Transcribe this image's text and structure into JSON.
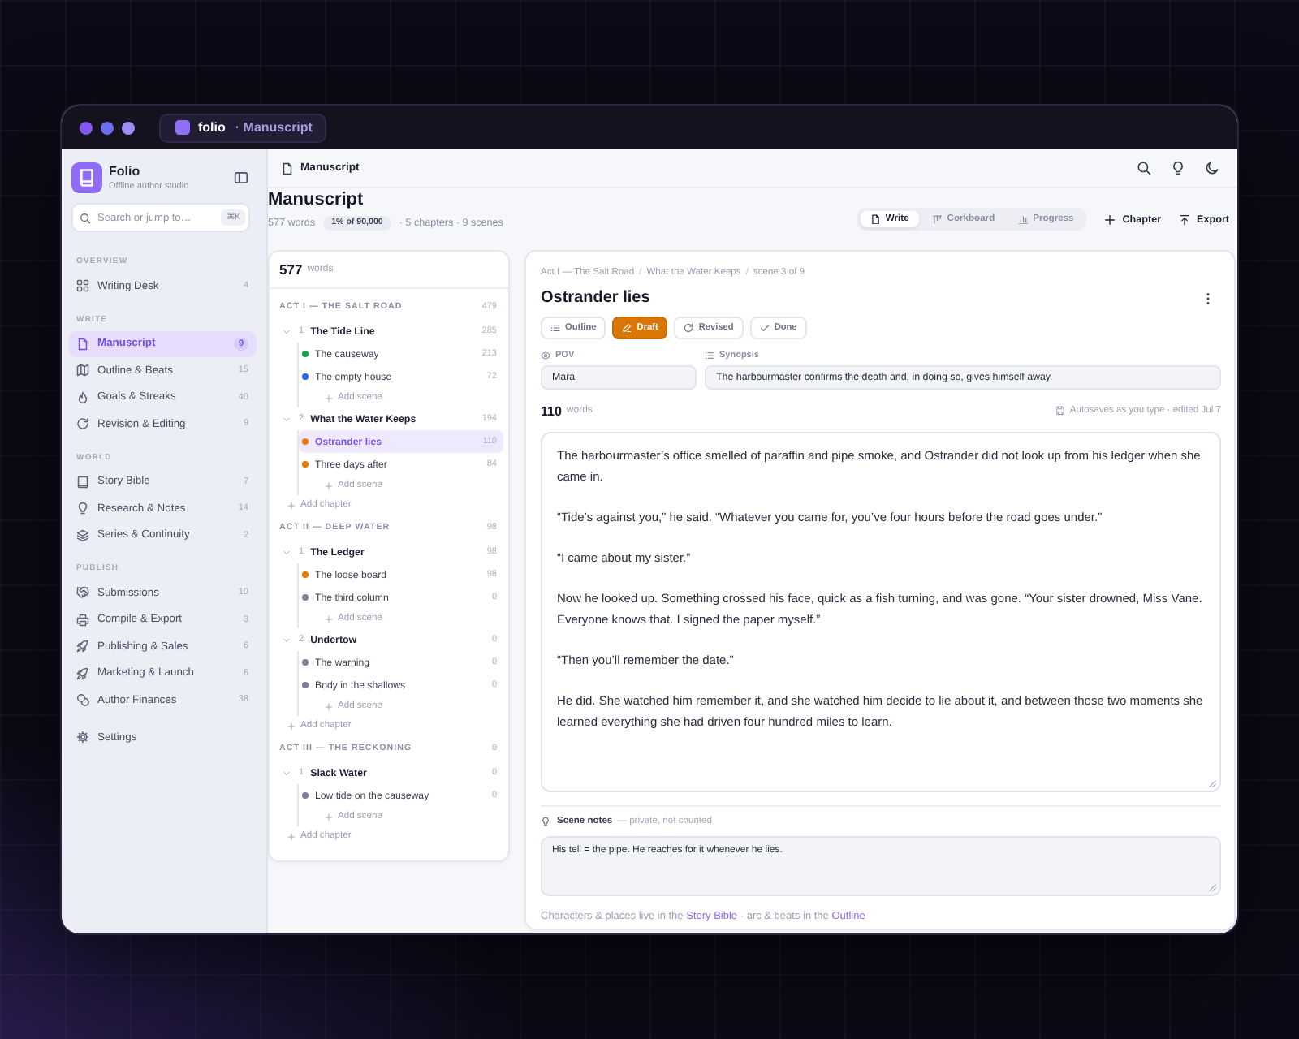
{
  "window": {
    "app_name": "folio",
    "page": "· Manuscript"
  },
  "sidebar": {
    "brand": {
      "name": "Folio",
      "tagline": "Offline author studio"
    },
    "search": {
      "placeholder": "Search or jump to…",
      "shortcut": "⌘K"
    },
    "sections": [
      {
        "heading": "OVERVIEW",
        "items": [
          {
            "label": "Writing Desk",
            "count": "4",
            "selected": false
          }
        ]
      },
      {
        "heading": "WRITE",
        "items": [
          {
            "label": "Manuscript",
            "count": "9",
            "selected": true
          },
          {
            "label": "Outline & Beats",
            "count": "15",
            "selected": false
          },
          {
            "label": "Goals & Streaks",
            "count": "40",
            "selected": false
          },
          {
            "label": "Revision & Editing",
            "count": "9",
            "selected": false
          }
        ]
      },
      {
        "heading": "WORLD",
        "items": [
          {
            "label": "Story Bible",
            "count": "7",
            "selected": false
          },
          {
            "label": "Research & Notes",
            "count": "14",
            "selected": false
          },
          {
            "label": "Series & Continuity",
            "count": "2",
            "selected": false
          }
        ]
      },
      {
        "heading": "PUBLISH",
        "items": [
          {
            "label": "Submissions",
            "count": "10",
            "selected": false
          },
          {
            "label": "Compile & Export",
            "count": "3",
            "selected": false
          },
          {
            "label": "Publishing & Sales",
            "count": "6",
            "selected": false
          },
          {
            "label": "Marketing & Launch",
            "count": "6",
            "selected": false
          },
          {
            "label": "Author Finances",
            "count": "38",
            "selected": false
          }
        ]
      },
      {
        "items": [
          {
            "label": "Settings",
            "selected": false
          }
        ]
      }
    ]
  },
  "top_bar": {
    "title": "Manuscript"
  },
  "page_header": {
    "title": "Manuscript",
    "words": "577 words",
    "goal": "1% of 90,000",
    "summary": "· 5 chapters · 9 scenes",
    "views": [
      {
        "label": "Write",
        "selected": true
      },
      {
        "label": "Corkboard",
        "selected": false
      },
      {
        "label": "Progress",
        "selected": false
      }
    ],
    "actions": [
      {
        "label": "Chapter"
      },
      {
        "label": "Export"
      }
    ]
  },
  "outline": {
    "total": "577",
    "unit": "words",
    "acts": [
      {
        "title": "ACT I — THE SALT ROAD",
        "count": "479",
        "chapters": [
          {
            "number": "1",
            "title": "The Tide Line",
            "count": "285",
            "expanded": true,
            "scenes": [
              {
                "title": "The causeway",
                "count": "213",
                "color": "#16a34a",
                "selected": false
              },
              {
                "title": "The empty house",
                "count": "72",
                "color": "#2563eb",
                "selected": false
              }
            ],
            "add_scene": "Add scene"
          },
          {
            "number": "2",
            "title": "What the Water Keeps",
            "count": "194",
            "expanded": true,
            "scenes": [
              {
                "title": "Ostrander lies",
                "count": "110",
                "color": "#e8770c",
                "selected": true
              },
              {
                "title": "Three days after",
                "count": "84",
                "color": "#e8770c",
                "selected": false
              }
            ],
            "add_scene": "Add scene"
          }
        ],
        "add_chapter": "Add chapter"
      },
      {
        "title": "ACT II — DEEP WATER",
        "count": "98",
        "chapters": [
          {
            "number": "1",
            "title": "The Ledger",
            "count": "98",
            "expanded": true,
            "scenes": [
              {
                "title": "The loose board",
                "count": "98",
                "color": "#e8770c",
                "selected": false
              },
              {
                "title": "The third column",
                "count": "0",
                "color": "#7c8196",
                "selected": false
              }
            ],
            "add_scene": "Add scene"
          },
          {
            "number": "2",
            "title": "Undertow",
            "count": "0",
            "expanded": true,
            "scenes": [
              {
                "title": "The warning",
                "count": "0",
                "color": "#7c8196",
                "selected": false
              },
              {
                "title": "Body in the shallows",
                "count": "0",
                "color": "#7c8196",
                "selected": false
              }
            ],
            "add_scene": "Add scene"
          }
        ],
        "add_chapter": "Add chapter"
      },
      {
        "title": "ACT III — THE RECKONING",
        "count": "0",
        "chapters": [
          {
            "number": "1",
            "title": "Slack Water",
            "count": "0",
            "expanded": true,
            "scenes": [
              {
                "title": "Low tide on the causeway",
                "count": "0",
                "color": "#7c8196",
                "selected": false
              }
            ],
            "add_scene": "Add scene"
          }
        ],
        "add_chapter": "Add chapter"
      }
    ]
  },
  "editor": {
    "breadcrumb": [
      {
        "text": "Act I — The Salt Road"
      },
      {
        "text": "/",
        "kind": "separator"
      },
      {
        "text": "What the Water Keeps"
      },
      {
        "text": "/",
        "kind": "separator"
      },
      {
        "text": "scene 3 of 9"
      }
    ],
    "title": "Ostrander lies",
    "statuses": [
      {
        "label": "Outline",
        "selected": false
      },
      {
        "label": "Draft",
        "selected": true
      },
      {
        "label": "Revised",
        "selected": false
      },
      {
        "label": "Done",
        "selected": false
      }
    ],
    "fields": [
      {
        "label": "POV",
        "value": "Mara"
      },
      {
        "label": "Synopsis",
        "value": "The harbourmaster confirms the death and, in doing so, gives himself away."
      }
    ],
    "word_count": "110",
    "word_unit": "words",
    "autosave": "Autosaves as you type · edited Jul 7",
    "paragraphs": [
      "The harbourmaster’s office smelled of paraffin and pipe smoke, and Ostrander did not look up from his ledger when she came in.",
      "“Tide’s against you,” he said. “Whatever you came for, you’ve four hours before the road goes under.”",
      "“I came about my sister.”",
      "Now he looked up. Something crossed his face, quick as a fish turning, and was gone. “Your sister drowned, Miss Vane. Everyone knows that. I signed the paper myself.”",
      "“Then you’ll remember the date.”",
      "He did. She watched him remember it, and she watched him decide to lie about it, and between those two moments she learned everything she had driven four hundred miles to learn."
    ],
    "notes": {
      "label": "Scene notes",
      "hint": "— private, not counted",
      "value": "His tell = the pipe. He reaches for it whenever he lies."
    },
    "footer": [
      {
        "text": "Characters & places live in the ",
        "kind": "text"
      },
      {
        "text": "Story Bible",
        "kind": "link"
      },
      {
        "text": " · arc & beats in the ",
        "kind": "text"
      },
      {
        "text": "Outline",
        "kind": "link"
      }
    ]
  }
}
